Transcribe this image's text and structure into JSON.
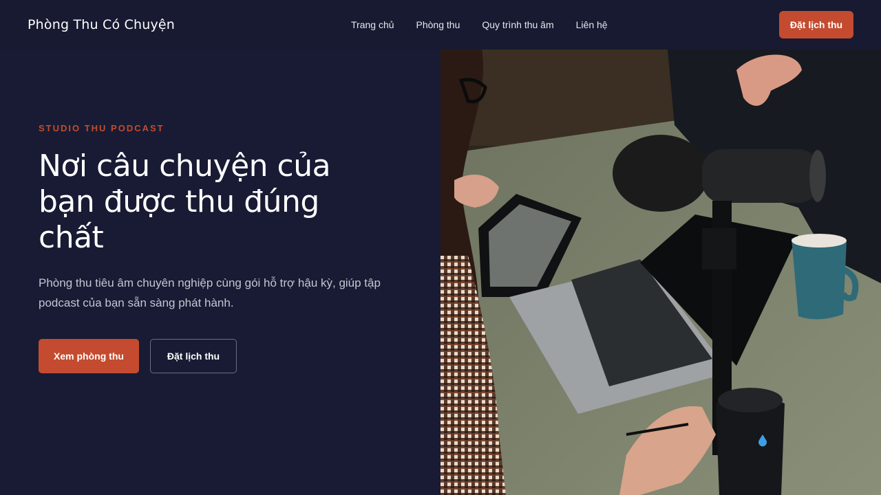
{
  "nav": {
    "brand": "Phòng Thu Có Chuyện",
    "links": [
      "Trang chủ",
      "Phòng thu",
      "Quy trình thu âm",
      "Liên hệ"
    ],
    "cta": "Đặt lịch thu"
  },
  "hero": {
    "eyebrow": "STUDIO THU PODCAST",
    "headline": "Nơi câu chuyện của bạn được thu đúng chất",
    "subtitle": "Phòng thu tiêu âm chuyên nghiệp cùng gói hỗ trợ hậu kỳ, giúp tập podcast của bạn sẵn sàng phát hành.",
    "primary_button": "Xem phòng thu",
    "secondary_button": "Đặt lịch thu"
  },
  "colors": {
    "background": "#181b33",
    "accent": "#c44b2f",
    "muted_text": "#c4c6d3"
  }
}
